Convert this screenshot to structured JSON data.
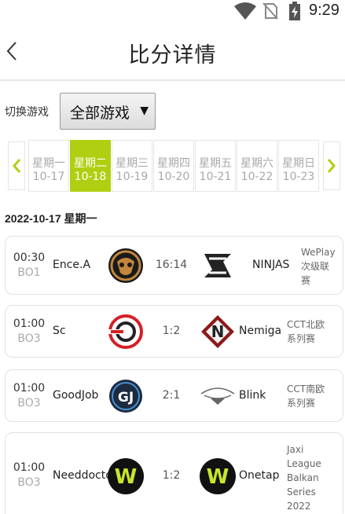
{
  "status": {
    "time": "9:29"
  },
  "nav": {
    "title": "比分详情"
  },
  "filter": {
    "label": "切换游戏",
    "selected": "全部游戏",
    "arrow": "▼"
  },
  "week": [
    {
      "day": "星期一",
      "date": "10-17",
      "active": false
    },
    {
      "day": "星期二",
      "date": "10-18",
      "active": true
    },
    {
      "day": "星期三",
      "date": "10-19",
      "active": false
    },
    {
      "day": "星期四",
      "date": "10-20",
      "active": false
    },
    {
      "day": "星期五",
      "date": "10-21",
      "active": false
    },
    {
      "day": "星期六",
      "date": "10-22",
      "active": false
    },
    {
      "day": "星期日",
      "date": "10-23",
      "active": false
    }
  ],
  "date_heading": "2022-10-17 星期一",
  "matches": [
    {
      "time": "00:30",
      "bo": "BO1",
      "team1": "Ence.A",
      "score": "16:14",
      "team2": "NINJAS",
      "league_lines": [
        "WePlay",
        "次级联",
        "赛"
      ],
      "logo1": "ence-logo-icon",
      "logo2": "ninjas-logo-icon"
    },
    {
      "time": "01:00",
      "bo": "BO3",
      "team1": "Sc",
      "score": "1:2",
      "team2": "Nemiga",
      "league_lines": [
        "CCT北欧",
        "系列赛"
      ],
      "logo1": "sc-logo-icon",
      "logo2": "nemiga-logo-icon"
    },
    {
      "time": "01:00",
      "bo": "BO3",
      "team1": "GoodJob",
      "score": "2:1",
      "team2": "Blink",
      "league_lines": [
        "CCT南欧",
        "系列赛"
      ],
      "logo1": "goodjob-logo-icon",
      "logo2": "blink-logo-icon"
    },
    {
      "time": "01:00",
      "bo": "BO3",
      "team1": "Needdocto",
      "score": "1:2",
      "team2": "Onetap",
      "league_lines": [
        "Jaxi",
        "League",
        "Balkan",
        "Series",
        "2022"
      ],
      "logo1": "w-logo-icon",
      "logo2": "w-logo-icon"
    }
  ],
  "colors": {
    "accent": "#b1cf12",
    "text": "#222222",
    "muted": "#aaaaaa"
  }
}
